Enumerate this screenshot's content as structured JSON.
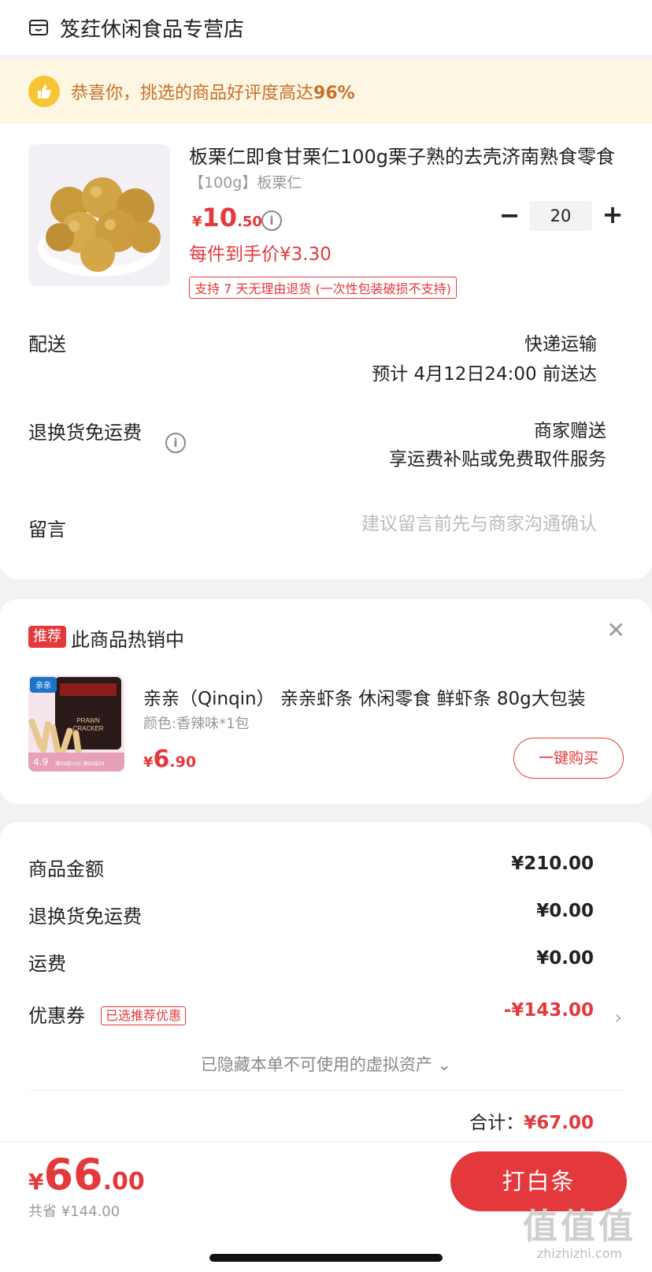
{
  "store": {
    "name": "笈荭休闲食品专营店",
    "icon": "store-icon"
  },
  "banner": {
    "text": "恭喜你，挑选的商品好评度高达",
    "percent": "96%",
    "icon": "thumbs-up-icon"
  },
  "product": {
    "title": "板栗仁即食甘栗仁100g栗子熟的去壳济南熟食零食",
    "spec": "【100g】板栗仁",
    "price_yen": "¥",
    "price_int": "10",
    "price_dec": ".50",
    "quantity": "20",
    "per_price": "每件到手价¥3.30",
    "return_tag": "支持 7 天无理由退货 (一次性包装破损不支持)"
  },
  "delivery": {
    "label": "配送",
    "method": "快递运输",
    "eta": "预计 4月12日24:00 前送达"
  },
  "return_shipping": {
    "label": "退换货免运费",
    "value": "商家赠送",
    "note": "享运费补贴或免费取件服务"
  },
  "message": {
    "label": "留言",
    "placeholder": "建议留言前先与商家沟通确认"
  },
  "recommend": {
    "badge": "推荐",
    "title": "此商品热销中",
    "name": "亲亲（Qinqin） 亲亲虾条 休闲零食 鲜虾条 80g大包装",
    "spec": "颜色:香辣味*1包",
    "price_yen": "¥",
    "price_int": "6",
    "price_dec": ".90",
    "buy_label": "一键购买",
    "img_rating": "4.9",
    "img_brand": "亲亲",
    "img_promo": "满39减10元 满99减30"
  },
  "summary": {
    "goods_label": "商品金额",
    "goods_value": "¥210.00",
    "return_label": "退换货免运费",
    "return_value": "¥0.00",
    "freight_label": "运费",
    "freight_value": "¥0.00",
    "coupon_label": "优惠券",
    "coupon_tag": "已选推荐优惠",
    "coupon_value": "-¥143.00",
    "hidden_assets": "已隐藏本单不可使用的虚拟资产 ⌄",
    "total_label": "合计：",
    "total_value": "¥67.00"
  },
  "footer": {
    "price_yen": "¥",
    "price_int": "66",
    "price_dec": ".00",
    "saved": "共省 ¥144.00",
    "pay_button": "打白条"
  },
  "watermark": {
    "big": "值值值",
    "small": "zhizhizhi.com"
  },
  "colors": {
    "accent": "#e4393c",
    "banner_bg": "#fdf6e3",
    "banner_text": "#c8702a"
  }
}
